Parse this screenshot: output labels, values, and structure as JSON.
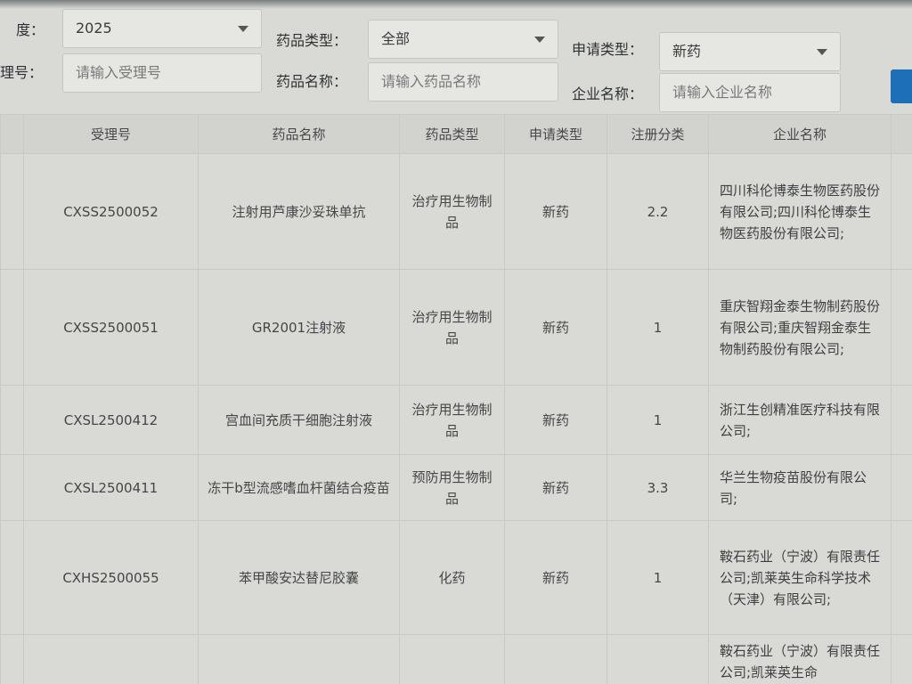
{
  "filters": {
    "year_label": "度：",
    "year_value": "2025",
    "drug_type_label": "药品类型：",
    "drug_type_value": "全部",
    "apply_type_label": "申请类型：",
    "apply_type_value": "新药",
    "accept_no_label": "理号：",
    "accept_no_placeholder": "请输入受理号",
    "drug_name_label": "药品名称：",
    "drug_name_placeholder": "请输入药品名称",
    "company_label": "企业名称：",
    "company_placeholder": "请输入企业名称"
  },
  "table": {
    "headers": [
      "受理号",
      "药品名称",
      "药品类型",
      "申请类型",
      "注册分类",
      "企业名称"
    ],
    "rows": [
      {
        "accept_no": "CXSS2500052",
        "drug_name": "注射用芦康沙妥珠单抗",
        "drug_type": "治疗用生物制品",
        "apply_type": "新药",
        "category": "2.2",
        "company": "四川科伦博泰生物医药股份有限公司;四川科伦博泰生物医药股份有限公司;"
      },
      {
        "accept_no": "CXSS2500051",
        "drug_name": "GR2001注射液",
        "drug_type": "治疗用生物制品",
        "apply_type": "新药",
        "category": "1",
        "company": "重庆智翔金泰生物制药股份有限公司;重庆智翔金泰生物制药股份有限公司;"
      },
      {
        "accept_no": "CXSL2500412",
        "drug_name": "宫血间充质干细胞注射液",
        "drug_type": "治疗用生物制品",
        "apply_type": "新药",
        "category": "1",
        "company": "浙江生创精准医疗科技有限公司;"
      },
      {
        "accept_no": "CXSL2500411",
        "drug_name": "冻干b型流感嗜血杆菌结合疫苗",
        "drug_type": "预防用生物制品",
        "apply_type": "新药",
        "category": "3.3",
        "company": "华兰生物疫苗股份有限公司;"
      },
      {
        "accept_no": "CXHS2500055",
        "drug_name": "苯甲酸安达替尼胶囊",
        "drug_type": "化药",
        "apply_type": "新药",
        "category": "1",
        "company": "鞍石药业（宁波）有限责任公司;凯莱英生命科学技术（天津）有限公司;"
      },
      {
        "accept_no": "",
        "drug_name": "",
        "drug_type": "",
        "apply_type": "",
        "category": "",
        "company": "鞍石药业（宁波）有限责任公司;凯莱英生命"
      }
    ]
  }
}
